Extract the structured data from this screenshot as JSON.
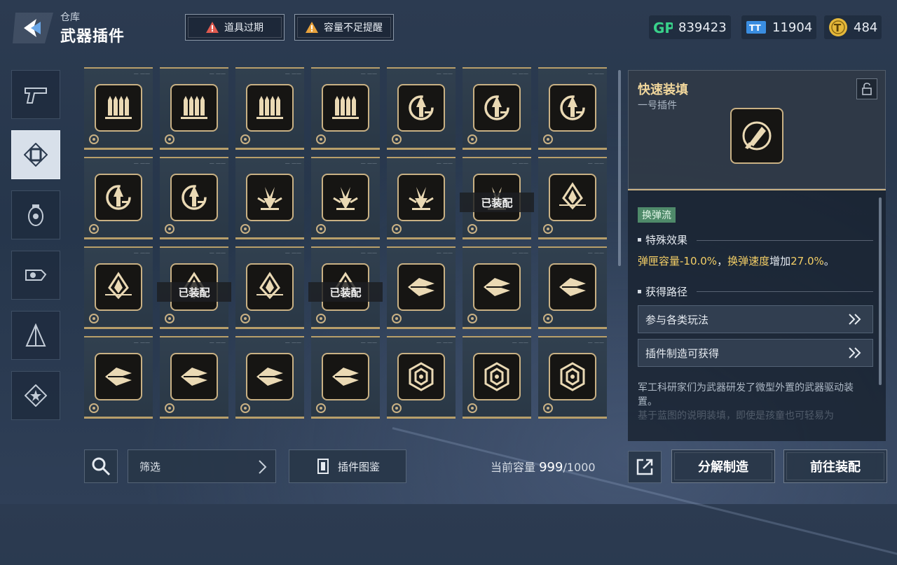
{
  "header": {
    "breadcrumb": "仓库",
    "title": "武器插件"
  },
  "alerts": [
    {
      "label": "道具过期"
    },
    {
      "label": "容量不足提醒"
    }
  ],
  "currencies": [
    {
      "icon": "gp-icon",
      "value": "839423"
    },
    {
      "icon": "ticket-icon",
      "value": "11904"
    },
    {
      "icon": "token-icon",
      "value": "484"
    }
  ],
  "sidebar": {
    "tabs": [
      {
        "icon": "pistol-icon",
        "active": false
      },
      {
        "icon": "plugin-chip-icon",
        "active": true
      },
      {
        "icon": "grenade-icon",
        "active": false
      },
      {
        "icon": "gear-hand-icon",
        "active": false
      },
      {
        "icon": "compass-tool-icon",
        "active": false
      },
      {
        "icon": "star-badge-icon",
        "active": false
      }
    ]
  },
  "grid": {
    "equipped_label": "已装配",
    "items": [
      {
        "icon": "bullets",
        "equipped": false
      },
      {
        "icon": "bullets",
        "equipped": false
      },
      {
        "icon": "bullets",
        "equipped": false
      },
      {
        "icon": "bullets",
        "equipped": false
      },
      {
        "icon": "reload",
        "equipped": false
      },
      {
        "icon": "reload",
        "equipped": false
      },
      {
        "icon": "reload",
        "equipped": false
      },
      {
        "icon": "reload",
        "equipped": false
      },
      {
        "icon": "reload",
        "equipped": false
      },
      {
        "icon": "burst",
        "equipped": false
      },
      {
        "icon": "burst",
        "equipped": false
      },
      {
        "icon": "burst",
        "equipped": false
      },
      {
        "icon": "burst",
        "equipped": true
      },
      {
        "icon": "diamond",
        "equipped": false
      },
      {
        "icon": "diamond",
        "equipped": false
      },
      {
        "icon": "diamond",
        "equipped": true
      },
      {
        "icon": "diamond",
        "equipped": false
      },
      {
        "icon": "diamond",
        "equipped": true
      },
      {
        "icon": "bolt",
        "equipped": false
      },
      {
        "icon": "bolt",
        "equipped": false
      },
      {
        "icon": "bolt",
        "equipped": false
      },
      {
        "icon": "bolt",
        "equipped": false
      },
      {
        "icon": "bolt",
        "equipped": false
      },
      {
        "icon": "bolt",
        "equipped": false
      },
      {
        "icon": "bolt",
        "equipped": false
      },
      {
        "icon": "hex",
        "equipped": false
      },
      {
        "icon": "hex",
        "equipped": false
      },
      {
        "icon": "hex",
        "equipped": false
      }
    ]
  },
  "detail": {
    "name": "快速装填",
    "subtitle": "一号插件",
    "tag": "换弹流",
    "effect_section": "特殊效果",
    "effect": {
      "part1_hl": "弹匣容量-10.0%",
      "sep": "，",
      "part2_hl": "换弹速度",
      "part3": "增加",
      "part4_hl": "27.0%",
      "end": "。"
    },
    "route_section": "获得路径",
    "routes": [
      {
        "label": "参与各类玩法"
      },
      {
        "label": "插件制造可获得"
      }
    ],
    "description": "军工科研家们为武器研发了微型外置的武器驱动装置。",
    "description_faded": "基于蓝图的说明装填，即使是孩童也可轻易为"
  },
  "bottom": {
    "filter_label": "筛选",
    "codex_label": "插件图鉴",
    "capacity_label": "当前容量",
    "capacity_current": "999",
    "capacity_max": "/1000",
    "dismantle_label": "分解制造",
    "equip_label": "前往装配"
  }
}
